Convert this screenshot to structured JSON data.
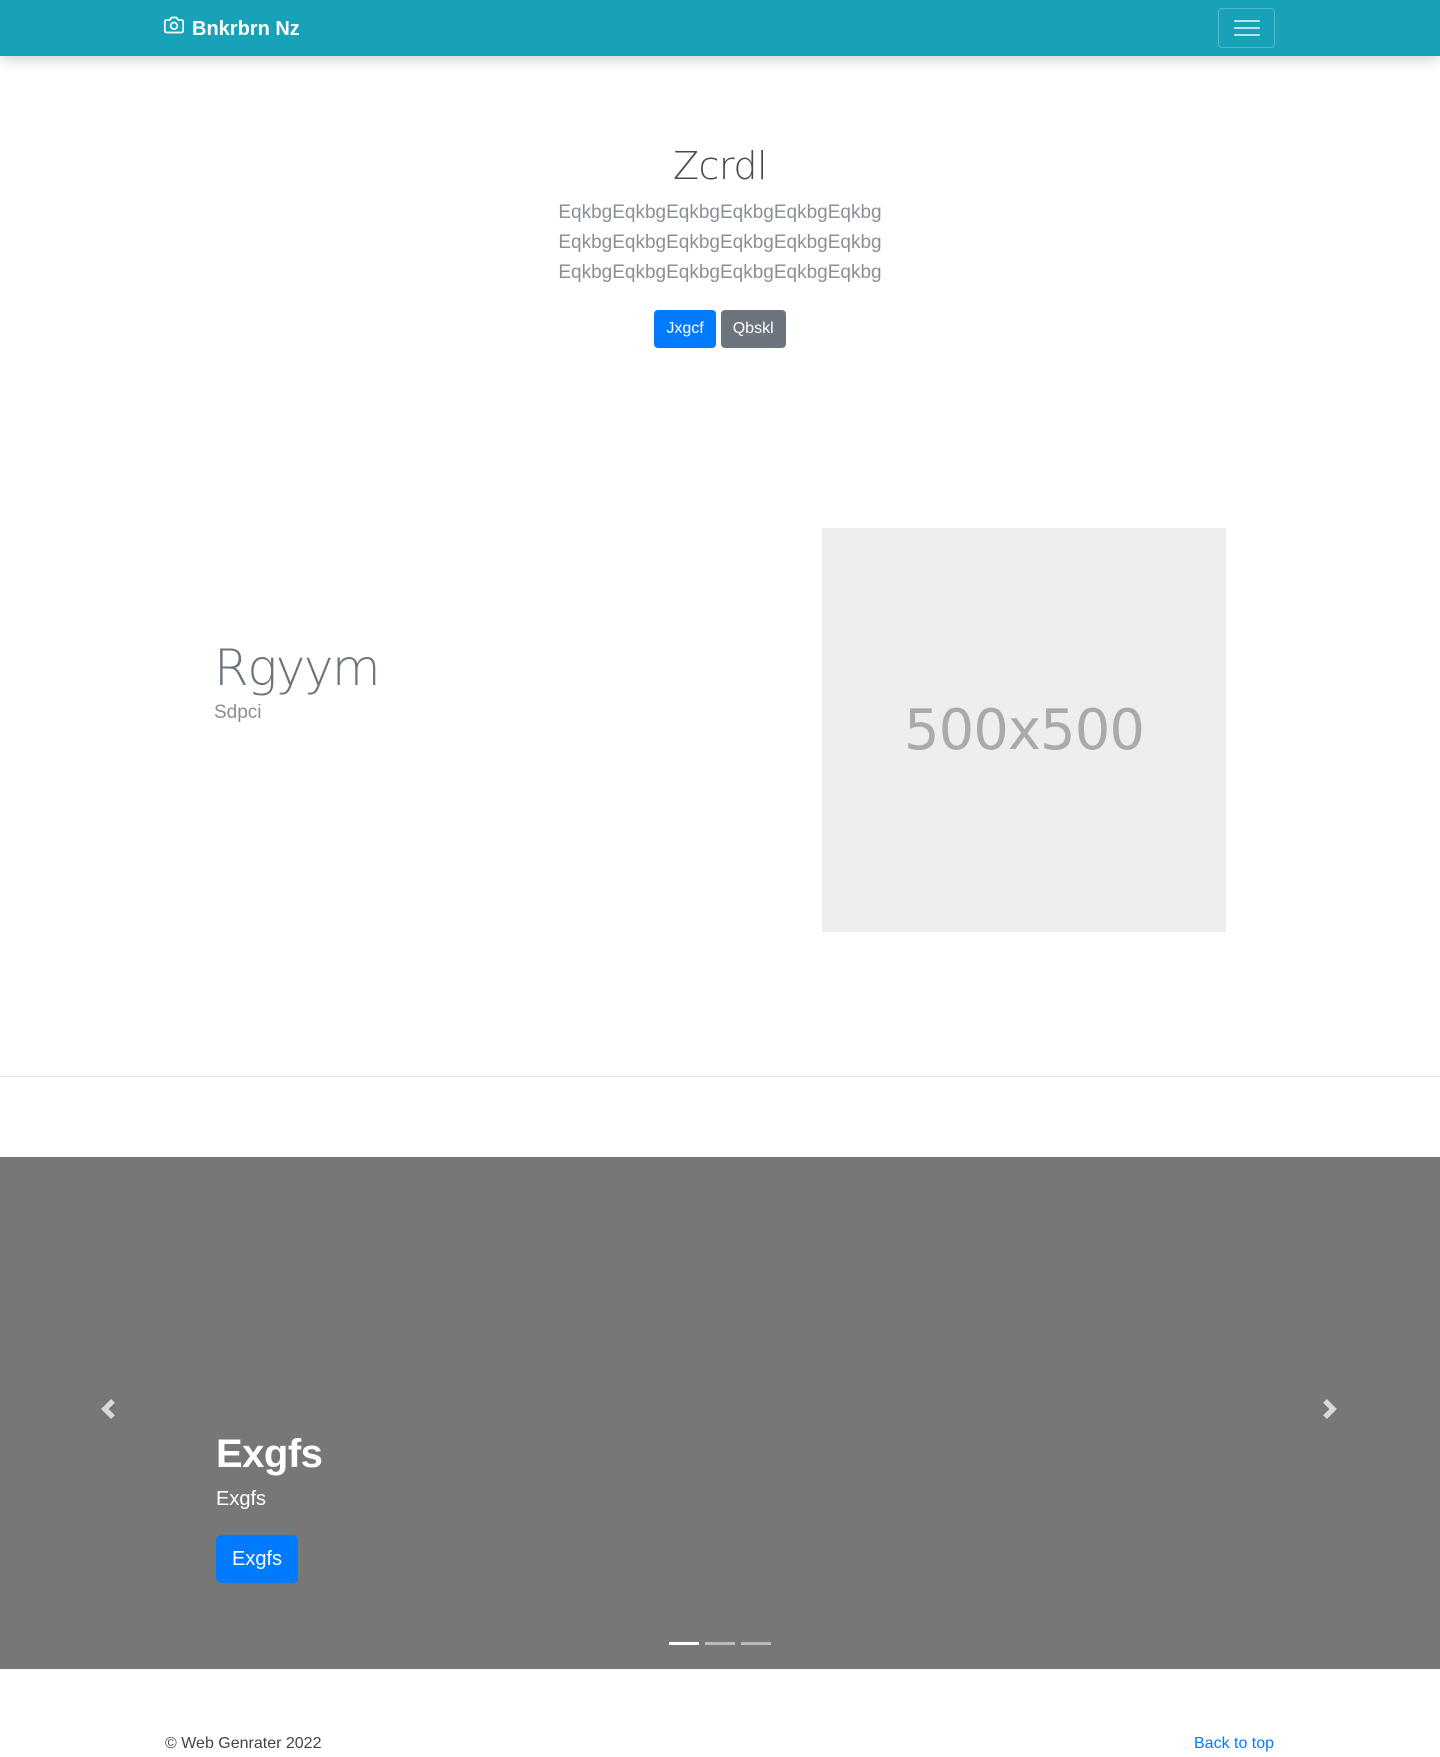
{
  "navbar": {
    "brand": "Bnkrbrn Nz",
    "brand_icon": "camera-icon",
    "toggler_icon": "hamburger-icon",
    "background": "#17a2b8"
  },
  "hero": {
    "title": "Zcrdl",
    "lead": "EqkbgEqkbgEqkbgEqkbgEqkbgEqkbgEqkbgEqkbgEqkbgEqkbgEqkbgEqkbgEqkbgEqkbgEqkbgEqkbgEqkbgEqkbg",
    "primary_button": "Jxgcf",
    "secondary_button": "Qbskl"
  },
  "feature": {
    "heading": "Rgyym",
    "subheading": "Sdpci",
    "image_label": "500x500"
  },
  "carousel": {
    "caption_title": "Exgfs",
    "caption_text": "Exgfs",
    "caption_button": "Exgfs",
    "prev_icon": "chevron-left-icon",
    "next_icon": "chevron-right-icon",
    "slide_count": 3,
    "active_slide": 1
  },
  "footer": {
    "copyright": "© Web Genrater 2022",
    "back_to_top": "Back to top"
  },
  "colors": {
    "primary": "#007bff",
    "secondary": "#6c757d",
    "carousel_bg": "#777777",
    "placeholder_bg": "#eeeeee"
  }
}
